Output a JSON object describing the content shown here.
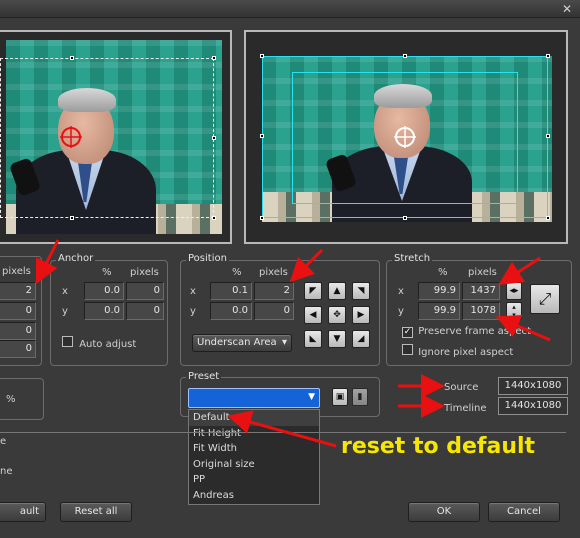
{
  "window": {
    "close_glyph": "✕"
  },
  "left_panel": {
    "pixels_header": "pixels",
    "values": [
      "2",
      "0",
      "0",
      "0"
    ],
    "percent_suffix": "%"
  },
  "anchor": {
    "title": "Anchor",
    "pct_header": "%",
    "px_header": "pixels",
    "x_label": "x",
    "y_label": "y",
    "x_pct": "0.0",
    "x_px": "0",
    "y_pct": "0.0",
    "y_px": "0",
    "auto_adjust_label": "Auto adjust",
    "auto_adjust_checked": false
  },
  "position": {
    "title": "Position",
    "pct_header": "%",
    "px_header": "pixels",
    "x_label": "x",
    "y_label": "y",
    "x_pct": "0.1",
    "x_px": "2",
    "y_pct": "0.0",
    "y_px": "0",
    "area_select": "Underscan Area",
    "nudge_icons": [
      "arrow-up-left-icon",
      "arrow-up-icon",
      "arrow-up-right-icon",
      "arrow-left-icon",
      "center-move-icon",
      "arrow-right-icon",
      "arrow-down-left-icon",
      "arrow-down-icon",
      "arrow-down-right-icon"
    ]
  },
  "stretch": {
    "title": "Stretch",
    "pct_header": "%",
    "px_header": "pixels",
    "x_label": "x",
    "y_label": "y",
    "x_pct": "99.9",
    "x_px": "1437",
    "y_pct": "99.9",
    "y_px": "1078",
    "preserve_label": "Preserve frame aspect",
    "preserve_checked": true,
    "ignore_label": "Ignore pixel aspect",
    "ignore_checked": false
  },
  "preset": {
    "title": "Preset",
    "selected": "",
    "options": [
      "Default",
      "Fit Height",
      "Fit Width",
      "Original size",
      "PP",
      "Andreas"
    ]
  },
  "info": {
    "source_label": "Source",
    "source_value": "1440x1080",
    "timeline_label": "Timeline",
    "timeline_value": "1440x1080"
  },
  "bottom_left": {
    "label_e": "e",
    "label_ne": "ne"
  },
  "annotation": {
    "text": "reset to default",
    "color": "#f7e600",
    "arrow_color": "#e81010"
  },
  "buttons": {
    "default_label": "ault",
    "reset_all_label": "Reset all",
    "ok_label": "OK",
    "cancel_label": "Cancel"
  },
  "colors": {
    "frame_cyan": "#27e2f0",
    "crosshair_red": "#e81010",
    "dropdown_blue": "#1464d8"
  }
}
